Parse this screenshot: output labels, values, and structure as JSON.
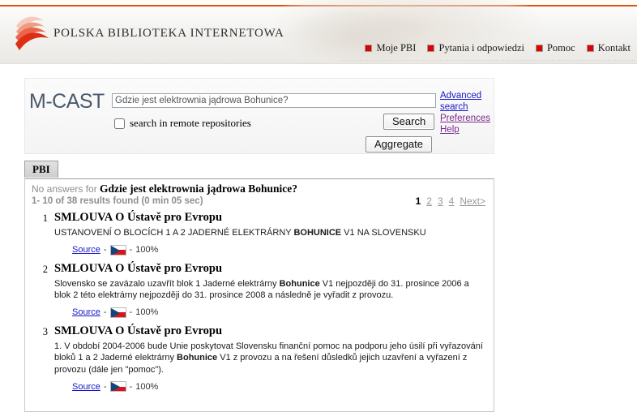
{
  "header": {
    "brand": "POLSKA BIBLIOTEKA  INTERNETOWA",
    "nav": [
      {
        "label": "Moje PBI",
        "icon": "red-square-icon"
      },
      {
        "label": "Pytania i odpowiedzi",
        "icon": "red-square-icon"
      },
      {
        "label": "Pomoc",
        "icon": "red-square-icon"
      },
      {
        "label": "Kontakt",
        "icon": "red-square-icon"
      }
    ]
  },
  "search": {
    "app_title": "M-CAST",
    "query_value": "Gdzie jest elektrownia jądrowa Bohunice?",
    "query_placeholder": "",
    "remote_label": "search in remote repositories",
    "remote_checked": false,
    "search_button": "Search",
    "aggregate_button": "Aggregate",
    "links": [
      {
        "label": "Advanced search",
        "style": "blue"
      },
      {
        "label": "Preferences",
        "style": "purple"
      },
      {
        "label": "Help",
        "style": "purple"
      }
    ]
  },
  "tabs": [
    {
      "label": "PBI",
      "active": true
    }
  ],
  "results_header": {
    "no_answers_prefix": "No answers for ",
    "query": "Gdzie jest elektrownia jądrowa Bohunice?",
    "count_line": "1- 10 of 38 results found (0 min 05 sec)"
  },
  "pagination": {
    "current": "1",
    "pages": [
      "2",
      "3",
      "4"
    ],
    "next_label": "Next>"
  },
  "results": [
    {
      "number": "1",
      "title": "SMLOUVA O Ústavě pro Evropu",
      "snippet_parts": [
        {
          "text": "USTANOVENÍ O BLOCÍCH 1 A 2 JADERNÉ ELEKTRÁRNY ",
          "bold": false
        },
        {
          "text": "BOHUNICE",
          "bold": true
        },
        {
          "text": " V1 NA SLOVENSKU",
          "bold": false
        }
      ],
      "source_label": "Source",
      "flag": "czech-flag-icon",
      "score": "100%"
    },
    {
      "number": "2",
      "title": "SMLOUVA O Ústavě pro Evropu",
      "snippet_parts": [
        {
          "text": "Slovensko se zavázalo uzavřít blok 1 Jaderné elektrárny ",
          "bold": false
        },
        {
          "text": "Bohunice",
          "bold": true
        },
        {
          "text": " V1 nejpozději do 31. prosince 2006 a blok 2 této elektrárny nejpozději do 31. prosince 2008 a následně je vyřadit z provozu.",
          "bold": false
        }
      ],
      "source_label": "Source",
      "flag": "czech-flag-icon",
      "score": "100%"
    },
    {
      "number": "3",
      "title": "SMLOUVA O Ústavě pro Evropu",
      "snippet_parts": [
        {
          "text": "1. V období 2004-2006 bude Unie poskytovat Slovensku finanční pomoc na podporu jeho úsilí při vyřazování bloků 1 a 2 Jaderné elektrárny ",
          "bold": false
        },
        {
          "text": "Bohunice",
          "bold": true
        },
        {
          "text": " V1 z provozu a na řešení důsledků jejich uzavření a vyřazení z provozu (dále jen \"pomoc\").",
          "bold": false
        }
      ],
      "source_label": "Source",
      "flag": "czech-flag-icon",
      "score": "100%"
    }
  ],
  "colors": {
    "accent_red": "#d4561f",
    "nav_bullet": "#e00000",
    "link_blue": "#1717c8",
    "link_visited": "#7a2a8c",
    "mcast_title": "#4a5a6a"
  }
}
